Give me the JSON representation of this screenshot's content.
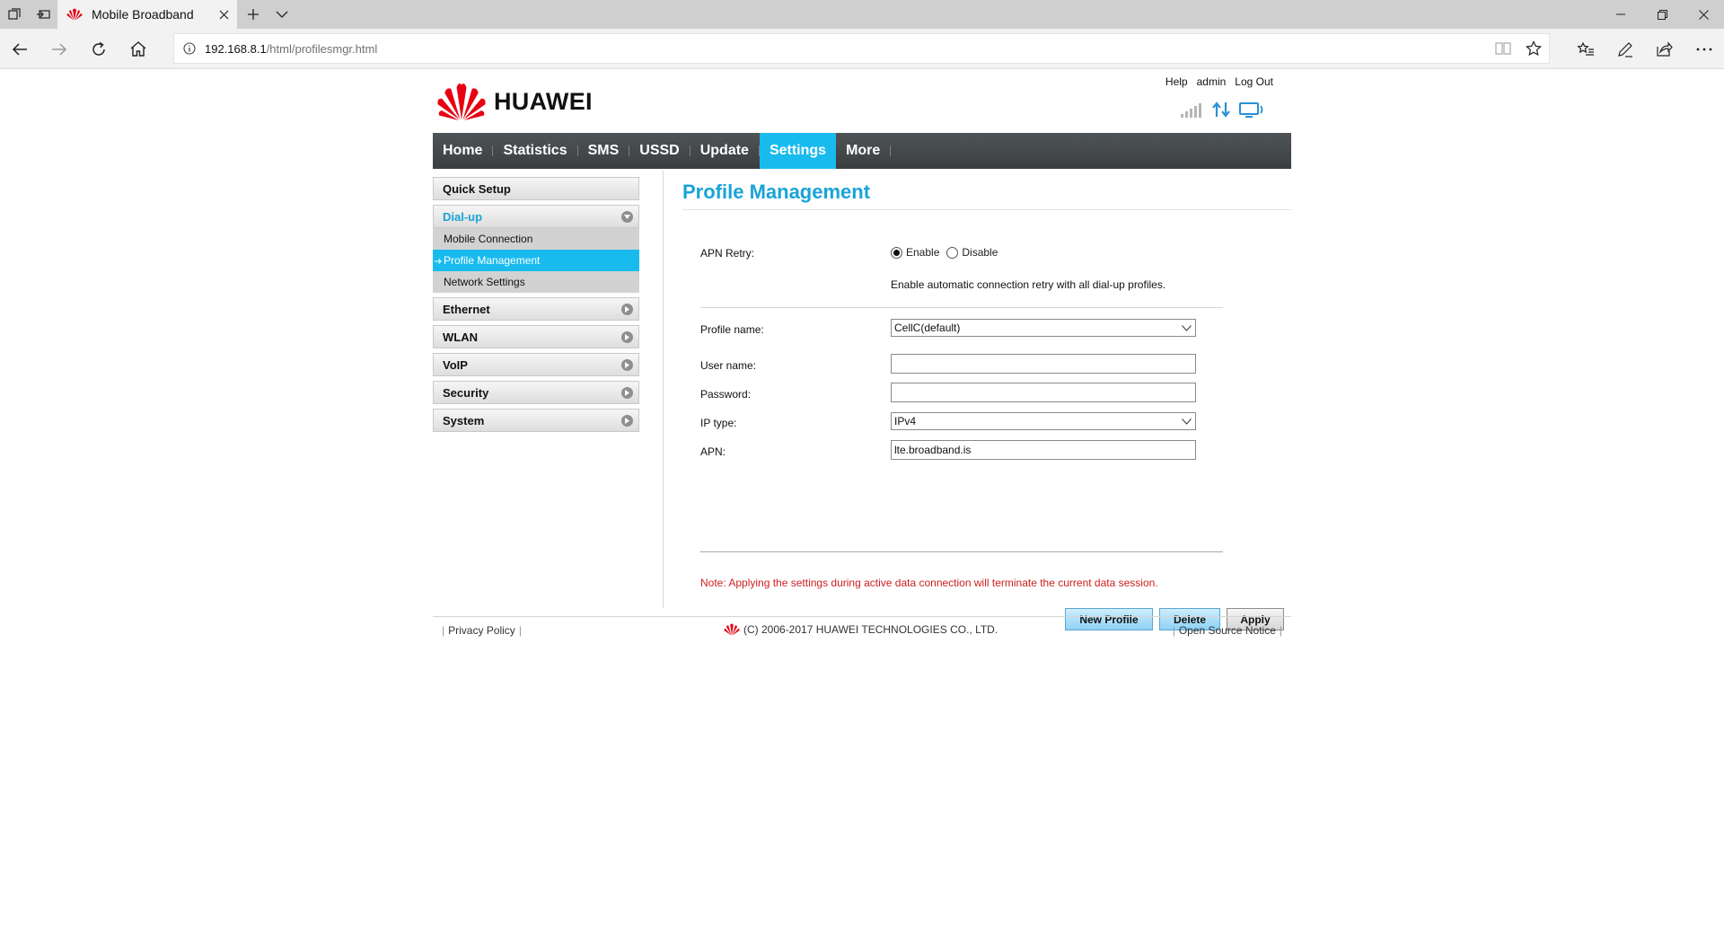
{
  "browser": {
    "tab_title": "Mobile Broadband",
    "url_host": "192.168.8.1",
    "url_path": "/html/profilesmgr.html"
  },
  "header": {
    "logo_text": "HUAWEI",
    "links": {
      "help": "Help",
      "user": "admin",
      "logout": "Log Out"
    },
    "brand_color": "#e60012"
  },
  "menu": {
    "items": [
      "Home",
      "Statistics",
      "SMS",
      "USSD",
      "Update",
      "Settings",
      "More"
    ],
    "active": "Settings",
    "active_color": "#19bbee"
  },
  "sidebar": {
    "quick_setup": "Quick Setup",
    "dialup": "Dial-up",
    "dialup_items": [
      "Mobile Connection",
      "Profile Management",
      "Network Settings"
    ],
    "active_item": "Profile Management",
    "sections": [
      "Ethernet",
      "WLAN",
      "VoIP",
      "Security",
      "System"
    ]
  },
  "content": {
    "title": "Profile Management",
    "apn_retry_label": "APN Retry:",
    "enable_label": "Enable",
    "disable_label": "Disable",
    "apn_retry_value": "Enable",
    "hint": "Enable automatic connection retry with all dial-up profiles.",
    "profile_name_label": "Profile name:",
    "profile_name_value": "CellC(default)",
    "user_name_label": "User name:",
    "user_name_value": "",
    "password_label": "Password:",
    "password_value": "",
    "ip_type_label": "IP type:",
    "ip_type_value": "IPv4",
    "apn_label": "APN:",
    "apn_value": "lte.broadband.is",
    "note": "Note: Applying the settings during active data connection will terminate the current data session.",
    "buttons": {
      "new_profile": "New Profile",
      "delete": "Delete",
      "apply": "Apply"
    }
  },
  "footer": {
    "privacy": "Privacy Policy",
    "copyright": "(C) 2006-2017 HUAWEI TECHNOLOGIES CO., LTD.",
    "open_source": "Open Source Notice"
  }
}
